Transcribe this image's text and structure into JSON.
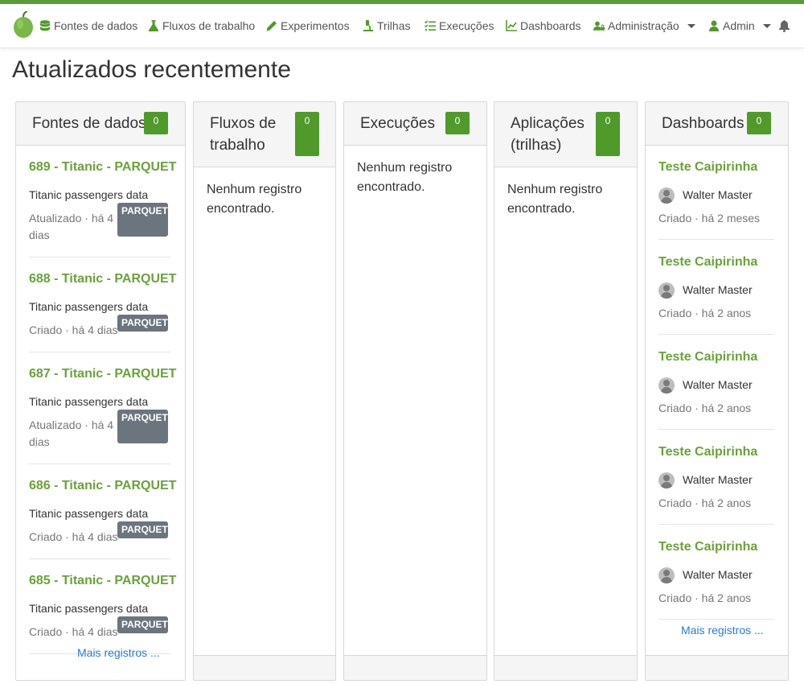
{
  "nav": {
    "items": [
      {
        "label": "Fontes de dados",
        "icon": "database-icon"
      },
      {
        "label": "Fluxos de trabalho",
        "icon": "flask-icon"
      },
      {
        "label": "Experimentos",
        "icon": "pencil-icon"
      },
      {
        "label": "Trilhas",
        "icon": "microscope-icon"
      },
      {
        "label": "Execuções",
        "icon": "task-list-icon"
      },
      {
        "label": "Dashboards",
        "icon": "chart-line-icon"
      },
      {
        "label": "Administração",
        "icon": "user-lock-icon"
      },
      {
        "label": "Admin",
        "icon": "user-icon"
      }
    ]
  },
  "page": {
    "title": "Atualizados recentemente"
  },
  "columns": {
    "datasources": {
      "title": "Fontes de dados",
      "count": "0",
      "more": "Mais registros ...",
      "items": [
        {
          "title": "689 - Titanic - PARQUET",
          "desc": "Titanic passengers data",
          "meta": "Atualizado · há 4 dias",
          "badge": "PARQUET"
        },
        {
          "title": "688 - Titanic - PARQUET",
          "desc": "Titanic passengers data",
          "meta": "Criado · há 4 dias",
          "badge": "PARQUET"
        },
        {
          "title": "687 - Titanic - PARQUET",
          "desc": "Titanic passengers data",
          "meta": "Atualizado · há 4 dias",
          "badge": "PARQUET"
        },
        {
          "title": "686 - Titanic - PARQUET",
          "desc": "Titanic passengers data",
          "meta": "Criado · há 4 dias",
          "badge": "PARQUET"
        },
        {
          "title": "685 - Titanic - PARQUET",
          "desc": "Titanic passengers data",
          "meta": "Criado · há 4 dias",
          "badge": "PARQUET"
        }
      ]
    },
    "workflows": {
      "title": "Fluxos de trabalho",
      "count": "0",
      "empty": "Nenhum registro encontrado."
    },
    "jobs": {
      "title": "Execuções",
      "count": "0",
      "empty": "Nenhum registro encontrado."
    },
    "apps": {
      "title": "Aplicações (trilhas)",
      "count": "0",
      "empty": "Nenhum registro encontrado."
    },
    "dashboards": {
      "title": "Dashboards",
      "count": "0",
      "more": "Mais registros ...",
      "items": [
        {
          "title": "Teste Caipirinha",
          "owner": "Walter Master",
          "meta": "Criado · há 2 meses"
        },
        {
          "title": "Teste Caipirinha",
          "owner": "Walter Master",
          "meta": "Criado · há 2 anos"
        },
        {
          "title": "Teste Caipirinha",
          "owner": "Walter Master",
          "meta": "Criado · há 2 anos"
        },
        {
          "title": "Teste Caipirinha",
          "owner": "Walter Master",
          "meta": "Criado · há 2 anos"
        },
        {
          "title": "Teste Caipirinha",
          "owner": "Walter Master",
          "meta": "Criado · há 2 anos"
        }
      ]
    }
  },
  "colors": {
    "brand": "#5a9a3a",
    "accent_text": "#6aa23a",
    "count_badge": "#4f9a2a",
    "type_badge": "#6c757d",
    "link": "#2a7ad6"
  }
}
